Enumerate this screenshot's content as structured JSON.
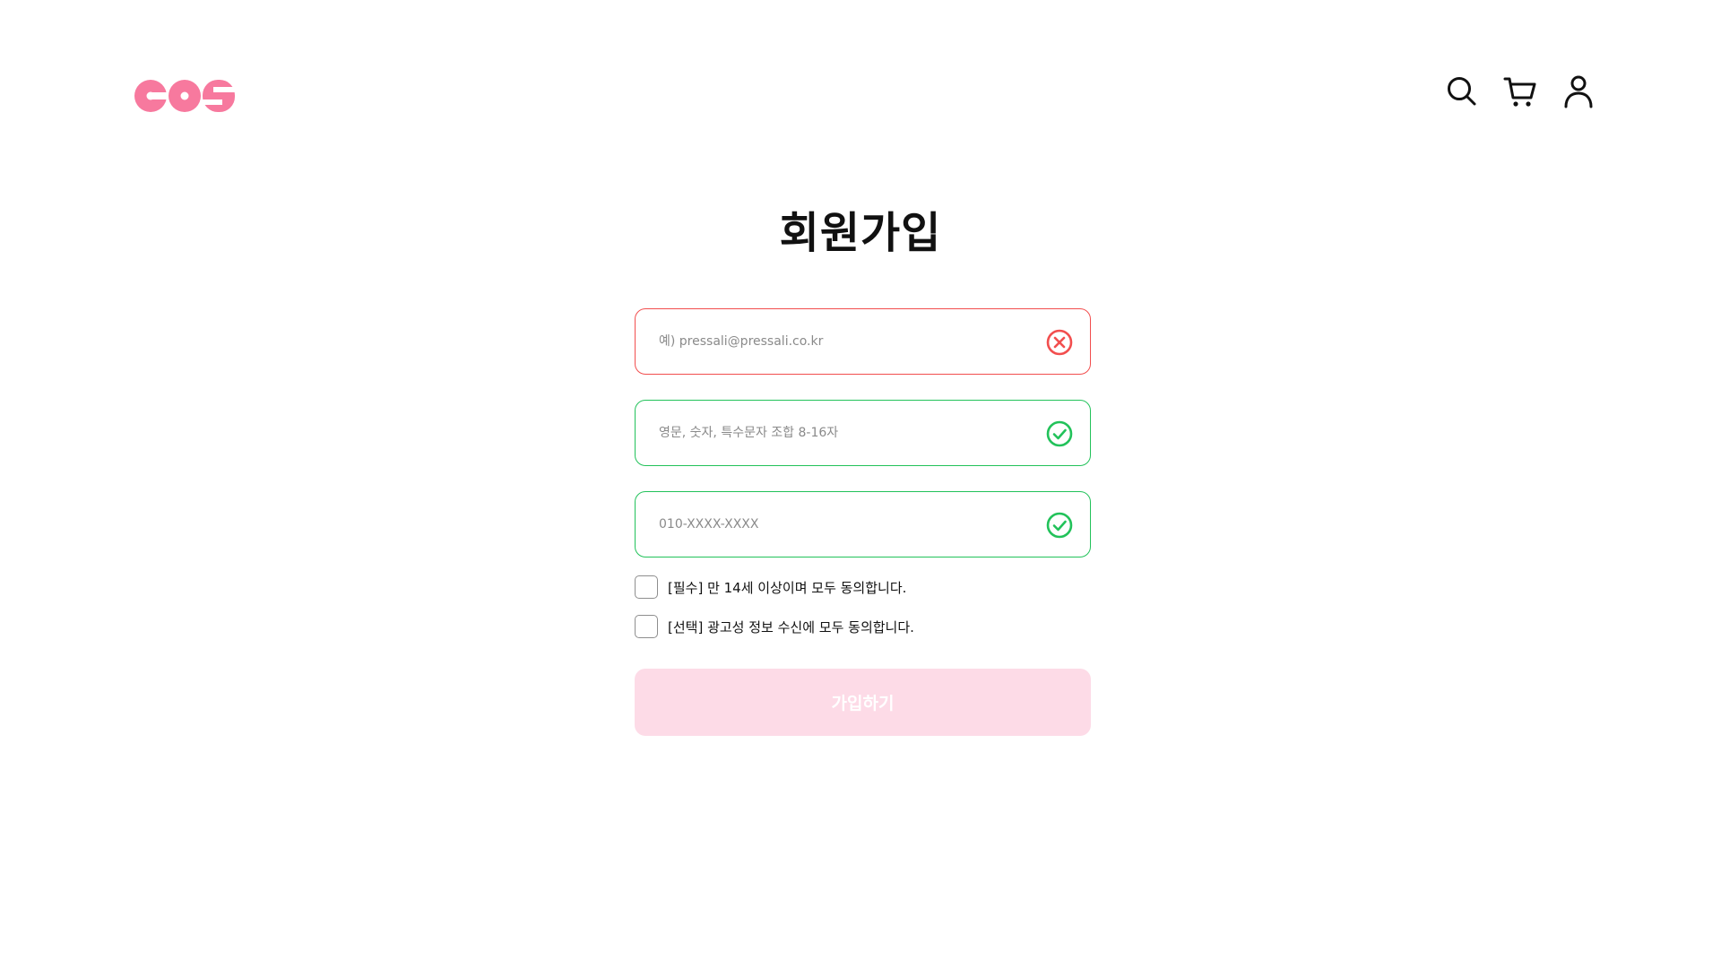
{
  "brand": {
    "logo_text": "cos",
    "logo_color": "#f7799e"
  },
  "header": {
    "icons": [
      "search-icon",
      "cart-icon",
      "user-icon"
    ]
  },
  "page": {
    "title": "회원가입"
  },
  "form": {
    "email": {
      "value": "",
      "placeholder": "예) pressali@pressali.co.kr",
      "status": "error"
    },
    "password": {
      "value": "",
      "placeholder": "영문, 숫자, 특수문자 조합 8-16자",
      "status": "valid"
    },
    "phone": {
      "value": "",
      "placeholder": "010-XXXX-XXXX",
      "status": "valid"
    },
    "consents": [
      {
        "label": "[필수] 만 14세 이상이며 모두 동의합니다.",
        "checked": false
      },
      {
        "label": "[선택] 광고성 정보 수신에 모두 동의합니다.",
        "checked": false
      }
    ],
    "submit_label": "가입하기"
  },
  "colors": {
    "error": "#f24e4e",
    "valid": "#22c25a",
    "submit_disabled_bg": "#fddbe7",
    "brand_pink": "#f7799e"
  }
}
